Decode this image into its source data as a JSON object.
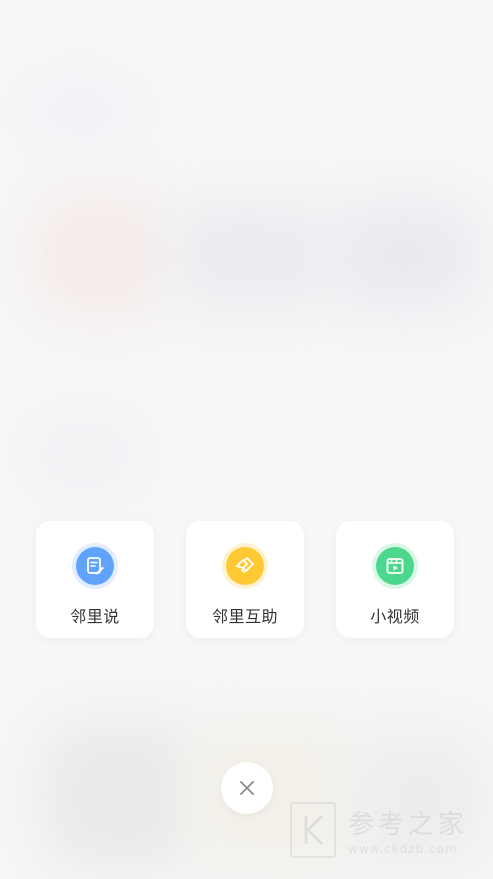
{
  "colors": {
    "card_bg": "#ffffff",
    "label_text": "#333333",
    "close_icon": "#8a8a8a",
    "blue_icon": "#5fa3ff",
    "yellow_icon": "#ffc933",
    "green_icon": "#4cd88c"
  },
  "menu": {
    "items": [
      {
        "label": "邻里说",
        "icon": "note-pen-icon",
        "accent": "#5fa3ff"
      },
      {
        "label": "邻里互助",
        "icon": "handshake-icon",
        "accent": "#ffc933"
      },
      {
        "label": "小视频",
        "icon": "video-clip-icon",
        "accent": "#4cd88c"
      }
    ]
  },
  "close": {
    "icon": "close-icon"
  },
  "watermark": {
    "title": "参考之家",
    "url": "www.ckdzb.com"
  }
}
